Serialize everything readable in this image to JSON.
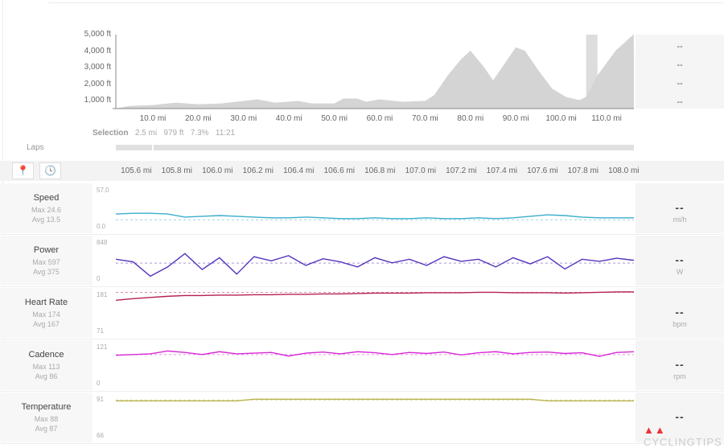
{
  "elevation": {
    "y_ticks": [
      "5,000 ft",
      "4,000 ft",
      "3,000 ft",
      "2,000 ft",
      "1,000 ft"
    ],
    "x_ticks": [
      "10.0 mi",
      "20.0 mi",
      "30.0 mi",
      "40.0 mi",
      "50.0 mi",
      "60.0 mi",
      "70.0 mi",
      "80.0 mi",
      "90.0 mi",
      "100.0 mi",
      "110.0 mi"
    ],
    "profile_mi": [
      0,
      5,
      10,
      15,
      20,
      25,
      30,
      33,
      37,
      42,
      45,
      50,
      52,
      55,
      57,
      60,
      65,
      70,
      72,
      75,
      78,
      80,
      83,
      85,
      87,
      90,
      92,
      95,
      98,
      101,
      104,
      105.5,
      108,
      112,
      116
    ],
    "profile_ft": [
      500,
      650,
      700,
      850,
      750,
      800,
      950,
      1050,
      850,
      950,
      800,
      800,
      1100,
      1100,
      900,
      1050,
      900,
      950,
      1300,
      2500,
      3500,
      4000,
      3000,
      2200,
      3000,
      4200,
      4000,
      2800,
      1700,
      1200,
      1000,
      1200,
      2500,
      4000,
      5000
    ],
    "selection_range_mi": [
      105.5,
      108
    ],
    "right_values": [
      "--",
      "--",
      "--",
      "--"
    ]
  },
  "selection": {
    "label": "Selection",
    "distance": "2.5 mi",
    "elevation": "979 ft",
    "grade": "7.3%",
    "time": "11:21"
  },
  "laps": {
    "label": "Laps"
  },
  "toolbar": {
    "icons": [
      "map-pin-icon",
      "clock-icon"
    ]
  },
  "detail_x_ticks": [
    "105.6 mi",
    "105.8 mi",
    "106.0 mi",
    "106.2 mi",
    "106.4 mi",
    "106.6 mi",
    "106.8 mi",
    "107.0 mi",
    "107.2 mi",
    "107.4 mi",
    "107.6 mi",
    "107.8 mi",
    "108.0 mi"
  ],
  "metrics": [
    {
      "name": "Speed",
      "max": "Max 24.6",
      "avg": "Avg 13.5",
      "ymax": "57.0",
      "ymin": "0.0",
      "value": "--",
      "unit": "mi/h",
      "color": "#3aaecb",
      "avg_value": 13.5,
      "lo": 0,
      "hi": 57,
      "series": [
        21,
        22,
        22,
        21,
        17,
        18,
        19,
        18,
        17,
        16,
        16,
        17,
        16,
        15,
        15,
        16,
        15,
        15,
        16,
        15,
        15,
        16,
        15,
        16,
        18,
        20,
        19,
        17,
        16,
        16,
        16
      ]
    },
    {
      "name": "Power",
      "max": "Max 597",
      "avg": "Avg 375",
      "ymax": "848",
      "ymin": "0",
      "value": "--",
      "unit": "W",
      "color": "#5533bb",
      "avg_value": 375,
      "lo": 0,
      "hi": 848,
      "series": [
        450,
        400,
        120,
        300,
        560,
        250,
        480,
        160,
        500,
        420,
        520,
        330,
        460,
        400,
        300,
        480,
        380,
        450,
        330,
        500,
        410,
        450,
        300,
        480,
        360,
        500,
        260,
        450,
        410,
        470,
        430
      ]
    },
    {
      "name": "Heart Rate",
      "max": "Max 174",
      "avg": "Avg 167",
      "ymax": "181",
      "ymin": "71",
      "value": "--",
      "unit": "bpm",
      "color": "#b5204f",
      "avg_value": 178,
      "lo": 71,
      "hi": 181,
      "series": [
        158,
        162,
        165,
        168,
        170,
        170,
        171,
        171,
        172,
        172,
        173,
        173,
        174,
        174,
        175,
        176,
        176,
        176,
        177,
        177,
        177,
        178,
        178,
        177,
        177,
        177,
        176,
        177,
        178,
        179,
        179
      ]
    },
    {
      "name": "Cadence",
      "max": "Max 113",
      "avg": "Avg 86",
      "ymax": "121",
      "ymin": "0",
      "value": "--",
      "unit": "rpm",
      "color": "#d62ad6",
      "avg_value": 90,
      "lo": 0,
      "hi": 121,
      "series": [
        88,
        90,
        92,
        100,
        96,
        90,
        98,
        92,
        94,
        96,
        86,
        94,
        97,
        92,
        98,
        95,
        90,
        96,
        93,
        97,
        89,
        95,
        98,
        92,
        96,
        97,
        93,
        95,
        85,
        96,
        98
      ]
    },
    {
      "name": "Temperature",
      "max": "Max 88",
      "avg": "Avg 87",
      "ymax": "91",
      "ymin": "66",
      "value": "--",
      "unit": "",
      "color": "#b9b24f",
      "avg_value": 88.5,
      "lo": 66,
      "hi": 91,
      "series": [
        88,
        88,
        88,
        88,
        88,
        88,
        88,
        88,
        89,
        89,
        89,
        89,
        89,
        89,
        89,
        89,
        89,
        89,
        89,
        89,
        89,
        89,
        89,
        89,
        89,
        88,
        88,
        88,
        88,
        88,
        88
      ]
    }
  ],
  "watermark": "CYCLINGTIPS"
}
